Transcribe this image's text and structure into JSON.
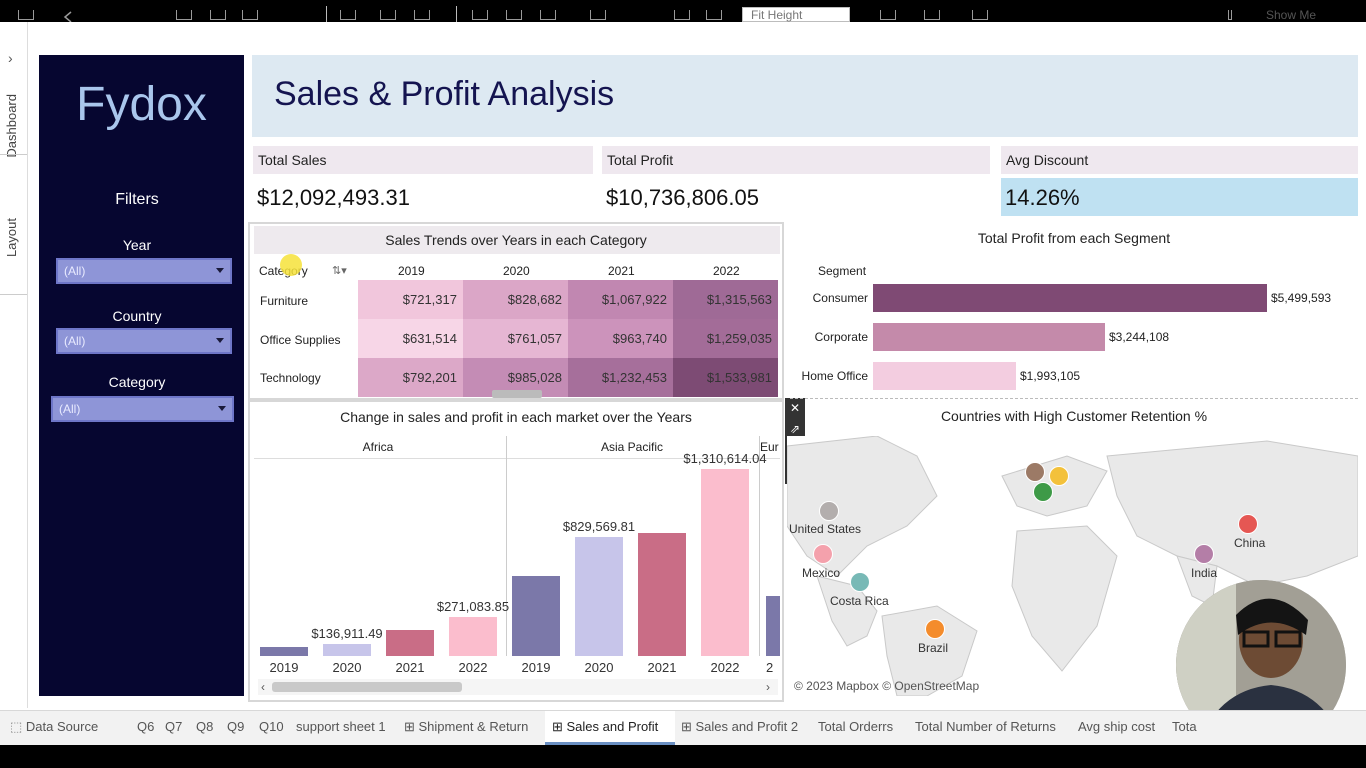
{
  "toolbar": {
    "fit_label": "Fit Height",
    "show_me_label": "Show Me"
  },
  "side_tabs": [
    "Dashboard",
    "Layout"
  ],
  "sidebar": {
    "brand": "Fydox",
    "filters_title": "Filters",
    "filters": [
      {
        "label": "Year",
        "value": "(All)"
      },
      {
        "label": "Country",
        "value": "(All)"
      },
      {
        "label": "Category",
        "value": "(All)"
      }
    ]
  },
  "header": {
    "title": "Sales & Profit Analysis"
  },
  "kpis": [
    {
      "label": "Total Sales",
      "value": "$12,092,493.31"
    },
    {
      "label": "Total Profit",
      "value": "$10,736,806.05"
    },
    {
      "label": "Avg Discount",
      "value": "14.26%"
    }
  ],
  "heatmap": {
    "title": "Sales Trends over Years in each Category",
    "category_header": "Category",
    "years": [
      "2019",
      "2020",
      "2021",
      "2022"
    ],
    "rows": [
      {
        "label": "Furniture",
        "values": [
          "$721,317",
          "$828,682",
          "$1,067,922",
          "$1,315,563"
        ]
      },
      {
        "label": "Office Supplies",
        "values": [
          "$631,514",
          "$761,057",
          "$963,740",
          "$1,259,035"
        ]
      },
      {
        "label": "Technology",
        "values": [
          "$792,201",
          "$985,028",
          "$1,232,453",
          "$1,533,981"
        ]
      }
    ],
    "colors": [
      [
        "#f1c6dc",
        "#dba6c7",
        "#c187b1",
        "#9f6a96"
      ],
      [
        "#f7d6e7",
        "#e6b6d3",
        "#cc93bb",
        "#a36c98"
      ],
      [
        "#dca8c8",
        "#c48cb5",
        "#a66f9b",
        "#7d4b74"
      ]
    ]
  },
  "segment_chart": {
    "title": "Total Profit from each Segment",
    "axis_label": "Segment",
    "bars": [
      {
        "label": "Consumer",
        "value": 5499593,
        "display": "$5,499,593",
        "color": "#7f4a74"
      },
      {
        "label": "Corporate",
        "value": 3244108,
        "display": "$3,244,108",
        "color": "#c48aaa"
      },
      {
        "label": "Home Office",
        "value": 1993105,
        "display": "$1,993,105",
        "color": "#f3cde0"
      }
    ],
    "max": 5499593
  },
  "chart_data": {
    "type": "bar",
    "title": "Change in sales and profit in each  market over the Years",
    "panels": [
      "Africa",
      "Asia Pacific",
      "Eur"
    ],
    "categories": [
      "2019",
      "2020",
      "2021",
      "2022"
    ],
    "series": [
      {
        "values": [
          60000,
          85000,
          180000,
          271083.85
        ]
      },
      {
        "values": [
          560000,
          829569.81,
          860000,
          1310614.04
        ]
      },
      {
        "values": [
          420000
        ]
      }
    ],
    "data_labels": {
      "Africa": {
        "2020": "$136,911.49",
        "2022": "$271,083.85"
      },
      "Asia Pacific": {
        "2020": "$829,569.81",
        "2022": "$1,310,614.04"
      }
    },
    "year_colors": [
      "#7b78a9",
      "#c7c5ea",
      "#c96d86",
      "#fbbdcd"
    ],
    "ylim": [
      0,
      1400000
    ]
  },
  "map": {
    "title": "Countries with High Customer Retention %",
    "attribution": "© 2023 Mapbox © OpenStreetMap",
    "points": [
      {
        "label": "United States",
        "color": "#b3aead"
      },
      {
        "label": "Mexico",
        "color": "#f4a1ac"
      },
      {
        "label": "Costa Rica",
        "color": "#78b9b6"
      },
      {
        "label": "Brazil",
        "color": "#f48c2c"
      },
      {
        "label": "China",
        "color": "#e55753"
      },
      {
        "label": "India",
        "color": "#b47ea7"
      },
      {
        "label": "",
        "color": "#9c7a66"
      },
      {
        "label": "",
        "color": "#f3c13b"
      },
      {
        "label": "",
        "color": "#3e9a47"
      }
    ]
  },
  "tabs": [
    "Data Source",
    "Q6",
    "Q7",
    "Q8",
    "Q9",
    "Q10",
    "support sheet 1",
    "Shipment & Return",
    "Sales and Profit",
    "Sales and Profit 2",
    "Total Orderrs",
    "Total Number of Returns",
    "Avg ship cost",
    "Tota"
  ],
  "active_tab": "Sales and Profit"
}
